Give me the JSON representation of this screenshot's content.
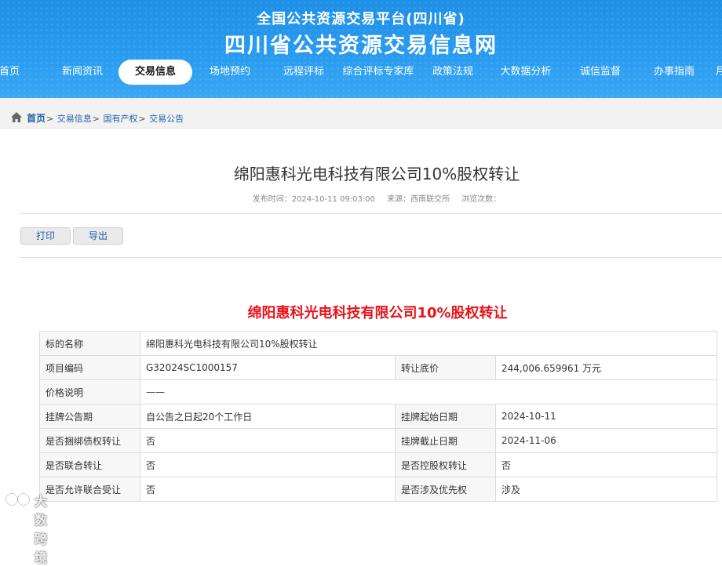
{
  "header": {
    "subtitle": "全国公共资源交易平台(四川省)",
    "title": "四川省公共资源交易信息网"
  },
  "nav": {
    "items": [
      {
        "label": "首页"
      },
      {
        "label": "新闻资讯"
      },
      {
        "label": "交易信息",
        "active": true
      },
      {
        "label": "场地预约"
      },
      {
        "label": "远程评标"
      },
      {
        "label": "综合评标专家库"
      },
      {
        "label": "政策法规"
      },
      {
        "label": "大数据分析"
      },
      {
        "label": "诚信监督"
      },
      {
        "label": "办事指南"
      },
      {
        "label": "月"
      }
    ]
  },
  "breadcrumb": {
    "home": "首页",
    "separator": ">",
    "items": [
      "交易信息",
      "国有产权",
      "交易公告"
    ]
  },
  "article": {
    "title": "绵阳惠科光电科技有限公司10%股权转让",
    "publish_time": "发布时间：2024-10-11 09:03:00",
    "source": "来源：西南联交所",
    "views": "浏览次数："
  },
  "actions": {
    "print": "打印",
    "export": "导出"
  },
  "announcement": {
    "title": "绵阳惠科光电科技有限公司10%股权转让",
    "rows": [
      {
        "l1": "标的名称",
        "v1": "绵阳惠科光电科技有限公司10%股权转让"
      },
      {
        "l1": "项目编码",
        "v1": "G32024SC1000157",
        "l2": "转让底价",
        "v2": "244,006.659961 万元"
      },
      {
        "l1": "价格说明",
        "v1": "——"
      },
      {
        "l1": "挂牌公告期",
        "v1": "自公告之日起20个工作日",
        "l2": "挂牌起始日期",
        "v2": "2024-10-11"
      },
      {
        "l1": "是否捆绑债权转让",
        "v1": "否",
        "l2": "挂牌截止日期",
        "v2": "2024-11-06"
      },
      {
        "l1": "是否联合转让",
        "v1": "否",
        "l2": "是否控股权转让",
        "v2": "否"
      },
      {
        "l1": "是否允许联合受让",
        "v1": "否",
        "l2": "是否涉及优先权",
        "v2": "涉及"
      }
    ]
  },
  "watermark": {
    "text": "大数跨境",
    "icon": "brand-logo-icon"
  },
  "colors": {
    "header_blue": "#2a9cf0",
    "accent_red": "#e8141b",
    "link_blue": "#1f5fa8"
  }
}
